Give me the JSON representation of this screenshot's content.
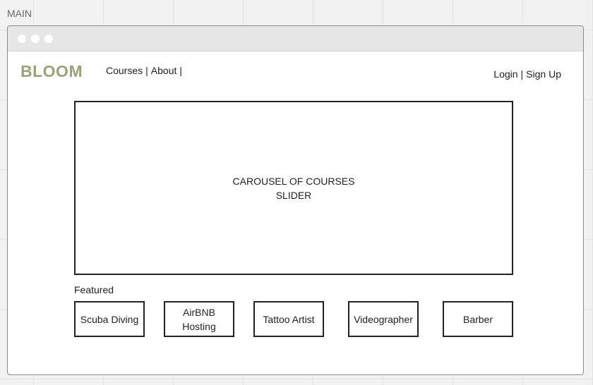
{
  "frame_label": "MAIN",
  "window": {
    "controls": [
      "window-dot",
      "window-dot",
      "window-dot"
    ]
  },
  "header": {
    "logo": "BLOOM",
    "nav_left": [
      {
        "label": "Courses"
      },
      {
        "label": "About"
      }
    ],
    "nav_right": [
      {
        "label": "Login"
      },
      {
        "label": "Sign Up"
      }
    ],
    "separator": "|"
  },
  "carousel": {
    "line1": "CAROUSEL OF COURSES",
    "line2": "SLIDER"
  },
  "featured": {
    "label": "Featured",
    "items": [
      {
        "label": "Scuba Diving"
      },
      {
        "label": "AirBNB Hosting"
      },
      {
        "label": "Tattoo Artist"
      },
      {
        "label": "Videographer"
      },
      {
        "label": "Barber"
      }
    ]
  },
  "colors": {
    "logo": "#9aa27a",
    "stroke": "#222222",
    "titlebar": "#e6e6e6",
    "canvas": "#f2f2f2"
  }
}
